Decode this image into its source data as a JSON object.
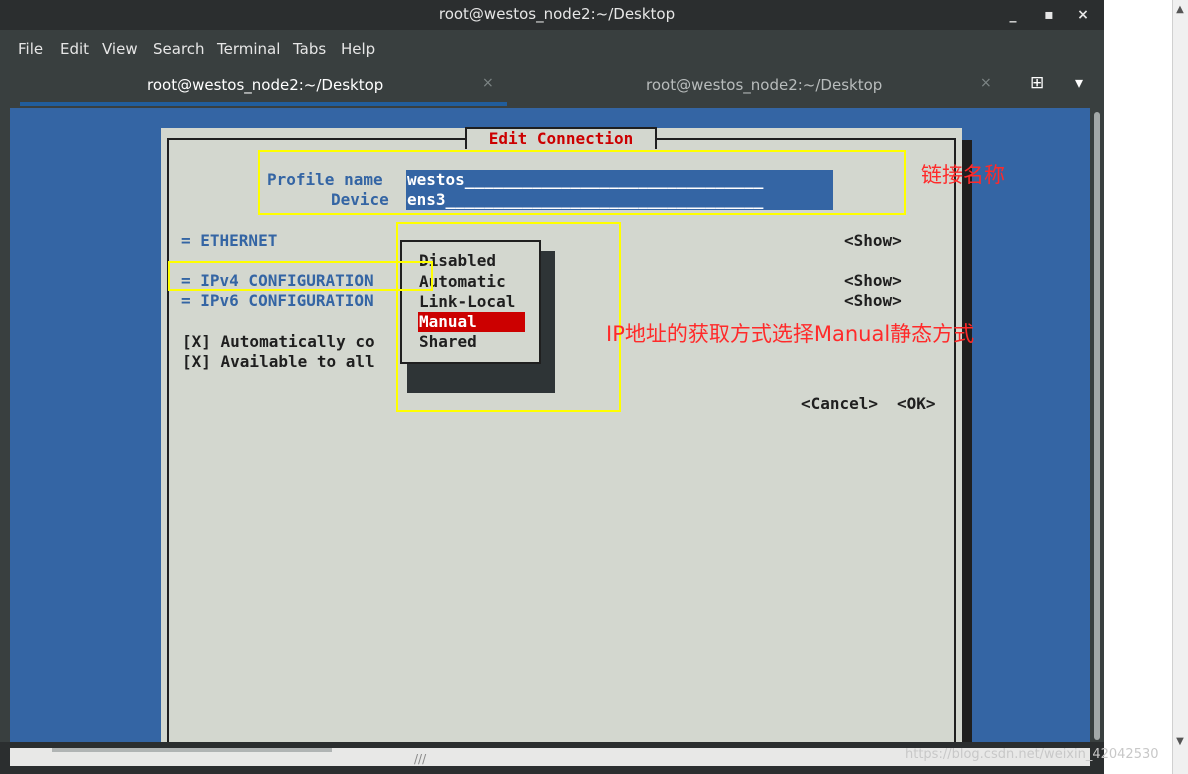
{
  "window": {
    "title": "root@westos_node2:~/Desktop",
    "controls": {
      "minimize": "_",
      "maximize": "▪",
      "close": "×"
    }
  },
  "menubar": {
    "items": [
      "File",
      "Edit",
      "View",
      "Search",
      "Terminal",
      "Tabs",
      "Help"
    ]
  },
  "tabs": [
    {
      "label": "root@westos_node2:~/Desktop",
      "active": true,
      "close": "×"
    },
    {
      "label": "root@westos_node2:~/Desktop",
      "active": false,
      "close": "×"
    }
  ],
  "tabbar_icons": {
    "new_tab": "new-tab-icon",
    "menu": "dropdown-arrow-icon",
    "new_tab_glyph": "⊞",
    "menu_glyph": "▾"
  },
  "dialog": {
    "title": "Edit Connection",
    "profile_name_label": "Profile name",
    "profile_name_value": "westos_______________________________",
    "device_label": "Device",
    "device_value": "ens3_________________________________",
    "ethernet_label": "= ETHERNET",
    "ipv4_label": "= IPv4 CONFIGURATION",
    "ipv6_label": "= IPv6 CONFIGURATION",
    "show_label": "<Show>",
    "auto_connect": "[X] Automatically co",
    "available_all": "[X] Available to all",
    "cancel_label": "<Cancel>",
    "ok_label": "<OK>"
  },
  "ipv4_method_popup": {
    "options": [
      "Disabled",
      "Automatic",
      "Link-Local",
      "Manual",
      "Shared"
    ],
    "selected": "Manual"
  },
  "annotations": {
    "profile": "链接名称",
    "method": "IP地址的获取方式选择Manual静态方式"
  },
  "colors": {
    "terminal_bg": "#3465a4",
    "dialog_bg": "#d3d7cf",
    "title_red": "#cc0000",
    "highlight_yellow": "#ffff00",
    "annotation_red": "#ff2a2a"
  },
  "watermark": "https://blog.csdn.net/weixin_42042530"
}
